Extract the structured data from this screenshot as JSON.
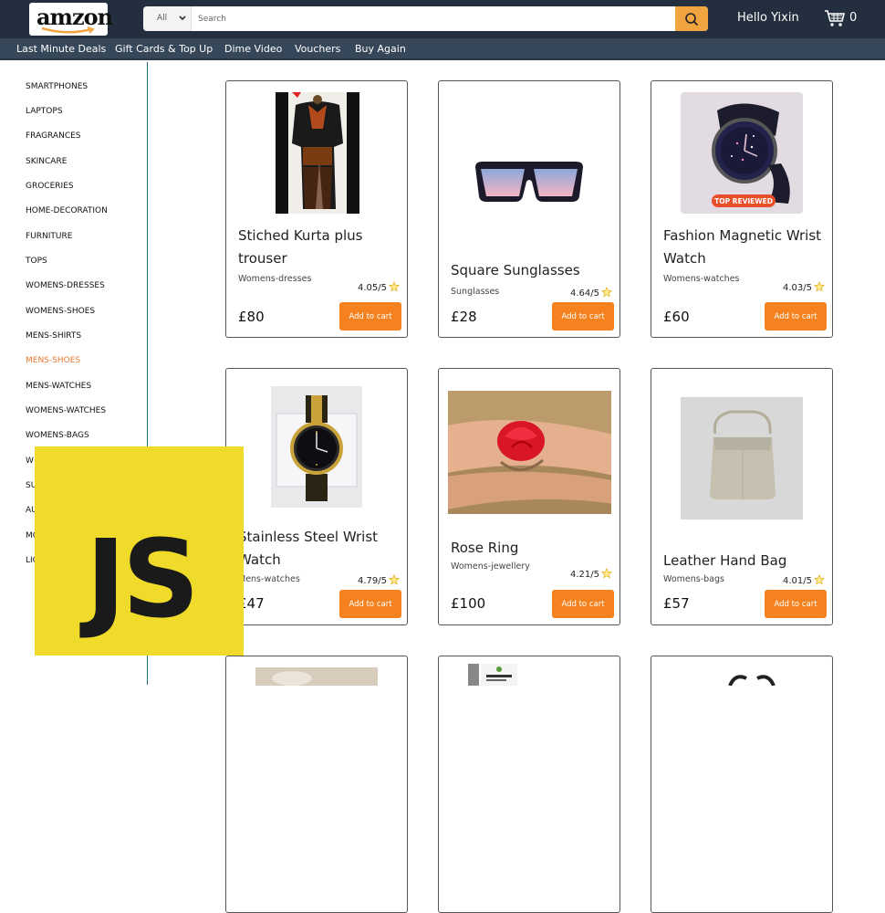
{
  "header": {
    "logo_text": "amzon",
    "search": {
      "category": "All",
      "placeholder": "Search"
    },
    "greeting": "Hello Yixin",
    "cart_count": "0"
  },
  "subnav": [
    "Last Minute Deals",
    "Gift Cards & Top Up",
    "Dime Video",
    "Vouchers",
    "Buy Again"
  ],
  "sidebar": {
    "categories": [
      "SMARTPHONES",
      "LAPTOPS",
      "FRAGRANCES",
      "SKINCARE",
      "GROCERIES",
      "HOME-DECORATION",
      "FURNITURE",
      "TOPS",
      "WOMENS-DRESSES",
      "WOMENS-SHOES",
      "MENS-SHIRTS",
      "MENS-SHOES",
      "MENS-WATCHES",
      "WOMENS-WATCHES",
      "WOMENS-BAGS",
      "W",
      "SU",
      "AU",
      "MO",
      "LIG"
    ],
    "active": "MENS-SHOES"
  },
  "products": [
    {
      "title": "Stiched Kurta plus trouser",
      "category": "Womens-dresses",
      "rating": "4.05/5",
      "price": "£80",
      "button": "Add to cart"
    },
    {
      "title": "Square Sunglasses",
      "category": "Sunglasses",
      "rating": "4.64/5",
      "price": "£28",
      "button": "Add to cart"
    },
    {
      "title": "Fashion Magnetic Wrist Watch",
      "category": "Womens-watches",
      "rating": "4.03/5",
      "price": "£60",
      "button": "Add to cart",
      "badge": "TOP REVIEWED"
    },
    {
      "title": "Stainless Steel Wrist Watch",
      "category": "Mens-watches",
      "rating": "4.79/5",
      "price": "£47",
      "button": "Add to cart"
    },
    {
      "title": "Rose Ring",
      "category": "Womens-jewellery",
      "rating": "4.21/5",
      "price": "£100",
      "button": "Add to cart"
    },
    {
      "title": "Leather Hand Bag",
      "category": "Womens-bags",
      "rating": "4.01/5",
      "price": "£57",
      "button": "Add to cart"
    }
  ],
  "overlay": {
    "badge_text": "JS"
  },
  "colors": {
    "topbar": "#232f3e",
    "subnav": "#37475a",
    "accent": "#f5821f",
    "active_category": "#e8772e",
    "js_yellow": "#f0db2a"
  }
}
